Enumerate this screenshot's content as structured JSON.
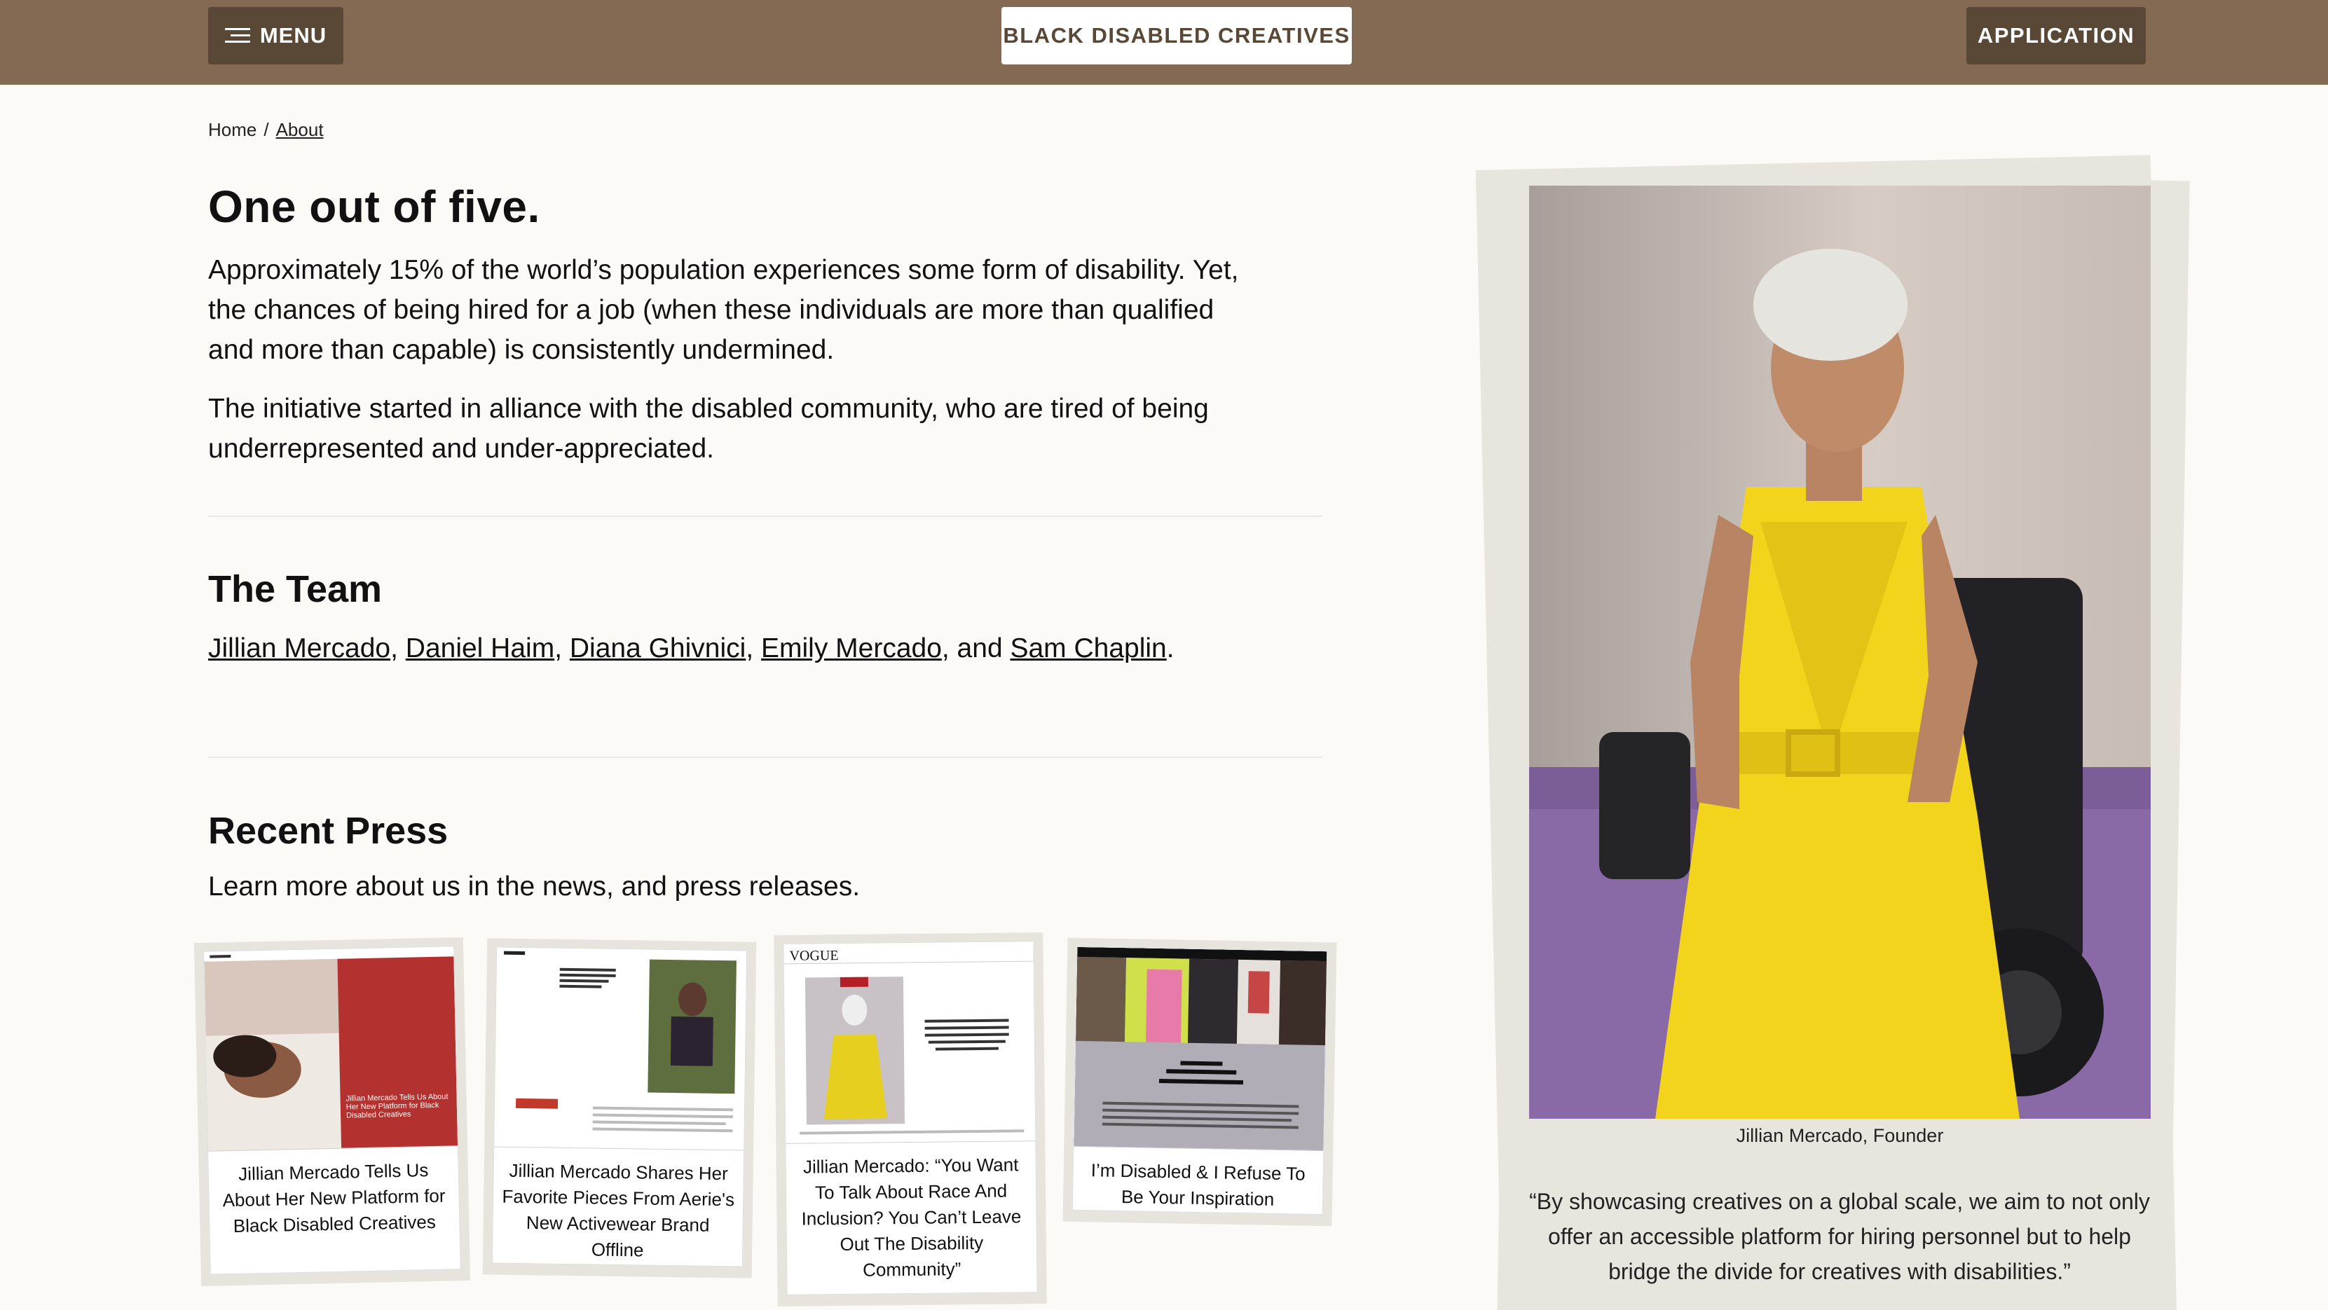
{
  "header": {
    "menu_label": "MENU",
    "brand_label": "BLACK DISABLED CREATIVES",
    "application_label": "APPLICATION"
  },
  "breadcrumb": {
    "home": "Home",
    "separator": "/",
    "current": "About"
  },
  "intro": {
    "title": "One out of five.",
    "paragraph1": "Approximately 15% of the world’s population experiences some form of disability. Yet, the chances of being hired for a job (when these individuals are more than qualified and more than capable) is consistently undermined.",
    "paragraph2": "The initiative started in alliance with the disabled community, who are tired of being underrepresented and under-appreciated."
  },
  "team": {
    "title": "The Team",
    "members": [
      "Jillian Mercado",
      "Daniel Haim",
      "Diana Ghivnici",
      "Emily Mercado",
      "Sam Chaplin"
    ],
    "sep1": ", ",
    "sep2": ", ",
    "sep3": ", ",
    "and": ", and ",
    "end": "."
  },
  "press": {
    "title": "Recent Press",
    "subtitle": "Learn more about us in the news, and press releases.",
    "items": [
      {
        "caption": "Jillian Mercado Tells Us About Her New Platform for Black Disabled Creatives",
        "thumb_text": "Jillian Mercado Tells Us About Her New Platform for Black Disabled Creatives"
      },
      {
        "caption": "Jillian Mercado Shares Her Favorite Pieces From Aerie's New Activewear Brand Offline"
      },
      {
        "caption": "Jillian Mercado: “You Want To Talk About Race And Inclusion? You Can’t Leave Out The Disability Community”",
        "thumb_logo": "VOGUE"
      },
      {
        "caption": "I’m Disabled & I Refuse To Be Your Inspiration"
      }
    ]
  },
  "founder": {
    "caption": "Jillian Mercado, Founder",
    "quote": "“By showcasing creatives on a global scale, we aim to not only offer an accessible platform for hiring personnel but to help bridge the divide for creatives with disabilities.”"
  },
  "colors": {
    "header_bg": "#856a53",
    "button_dark": "#5a4837",
    "page_bg": "#fbfaf7",
    "frame_bg": "#e8e4de"
  }
}
